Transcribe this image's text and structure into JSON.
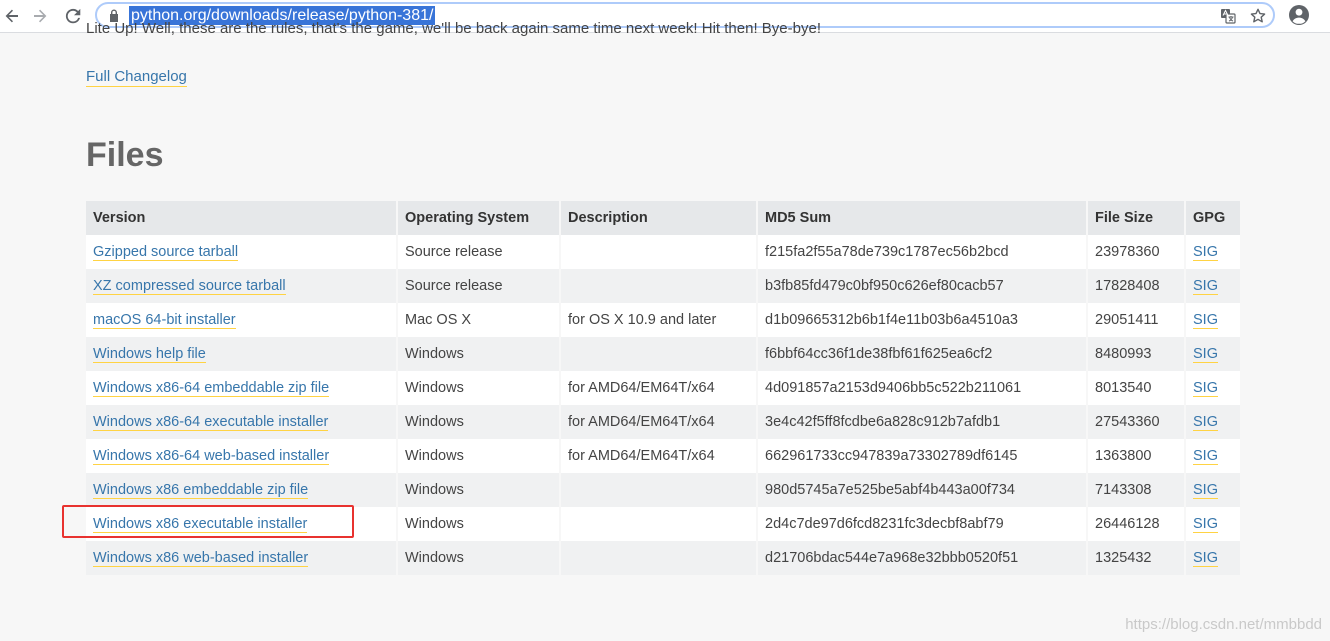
{
  "browser": {
    "url": "python.org/downloads/release/python-381/"
  },
  "page": {
    "cut_text": "Lite Up! Well, these are the rules, that's the game, we'll be back again same time next week! Hit then! Bye-bye!",
    "changelog_link": "Full Changelog",
    "files_heading": "Files"
  },
  "table": {
    "headers": [
      "Version",
      "Operating System",
      "Description",
      "MD5 Sum",
      "File Size",
      "GPG"
    ],
    "rows": [
      {
        "version": "Gzipped source tarball",
        "os": "Source release",
        "description": "",
        "md5": "f215fa2f55a78de739c1787ec56b2bcd",
        "size": "23978360",
        "gpg": "SIG"
      },
      {
        "version": "XZ compressed source tarball",
        "os": "Source release",
        "description": "",
        "md5": "b3fb85fd479c0bf950c626ef80cacb57",
        "size": "17828408",
        "gpg": "SIG"
      },
      {
        "version": "macOS 64-bit installer",
        "os": "Mac OS X",
        "description": "for OS X 10.9 and later",
        "md5": "d1b09665312b6b1f4e11b03b6a4510a3",
        "size": "29051411",
        "gpg": "SIG"
      },
      {
        "version": "Windows help file",
        "os": "Windows",
        "description": "",
        "md5": "f6bbf64cc36f1de38fbf61f625ea6cf2",
        "size": "8480993",
        "gpg": "SIG"
      },
      {
        "version": "Windows x86-64 embeddable zip file",
        "os": "Windows",
        "description": "for AMD64/EM64T/x64",
        "md5": "4d091857a2153d9406bb5c522b211061",
        "size": "8013540",
        "gpg": "SIG"
      },
      {
        "version": "Windows x86-64 executable installer",
        "os": "Windows",
        "description": "for AMD64/EM64T/x64",
        "md5": "3e4c42f5ff8fcdbe6a828c912b7afdb1",
        "size": "27543360",
        "gpg": "SIG"
      },
      {
        "version": "Windows x86-64 web-based installer",
        "os": "Windows",
        "description": "for AMD64/EM64T/x64",
        "md5": "662961733cc947839a73302789df6145",
        "size": "1363800",
        "gpg": "SIG"
      },
      {
        "version": "Windows x86 embeddable zip file",
        "os": "Windows",
        "description": "",
        "md5": "980d5745a7e525be5abf4b443a00f734",
        "size": "7143308",
        "gpg": "SIG"
      },
      {
        "version": "Windows x86 executable installer",
        "os": "Windows",
        "description": "",
        "md5": "2d4c7de97d6fcd8231fc3decbf8abf79",
        "size": "26446128",
        "gpg": "SIG"
      },
      {
        "version": "Windows x86 web-based installer",
        "os": "Windows",
        "description": "",
        "md5": "d21706bdac544e7a968e32bbb0520f51",
        "size": "1325432",
        "gpg": "SIG"
      }
    ]
  },
  "watermark": "https://blog.csdn.net/mmbbdd",
  "icons": {
    "back": "arrow-left-icon",
    "forward": "arrow-right-icon",
    "reload": "reload-icon",
    "lock": "lock-icon",
    "translate": "translate-icon",
    "bookmark": "star-icon",
    "profile": "avatar-icon"
  },
  "colors": {
    "link": "#3776ab",
    "link_underline": "#ffd343",
    "highlight_box": "#e8322f",
    "url_selection": "#3874d8"
  }
}
